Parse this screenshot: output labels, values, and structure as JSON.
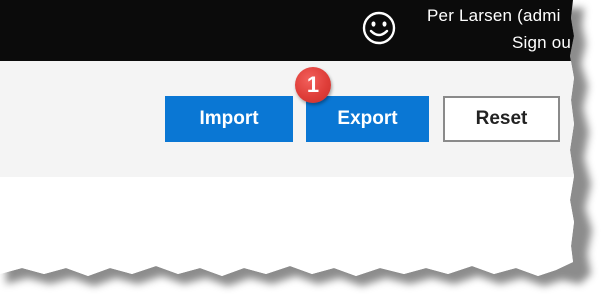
{
  "header": {
    "user_name": "Per Larsen (admi",
    "sign_out": "Sign ou",
    "smiley_icon": "smiley-face-icon"
  },
  "toolbar": {
    "import_label": "Import",
    "export_label": "Export",
    "reset_label": "Reset"
  },
  "annotation": {
    "callout_number": "1",
    "callout_color": "#df3e39"
  },
  "colors": {
    "topbar": "#0b0b0b",
    "primary_button": "#0a77d4",
    "toolbar_bg": "#f4f4f4"
  }
}
